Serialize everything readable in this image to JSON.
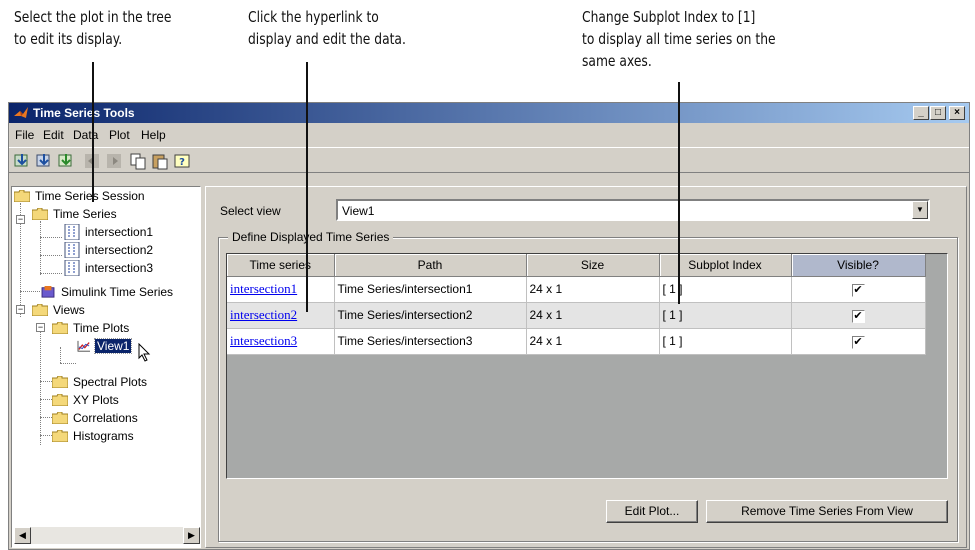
{
  "annotations": {
    "tree_note": [
      "Select the plot in the tree",
      "to edit its display."
    ],
    "link_note": [
      "Click the hyperlink to",
      "display and edit the data."
    ],
    "subplot_note": [
      "Change Subplot Index to [1]",
      "to display all time series on the",
      "same axes."
    ]
  },
  "window": {
    "title": "Time Series Tools",
    "controls": [
      "_",
      "□",
      "×"
    ]
  },
  "menu": [
    "File",
    "Edit",
    "Data",
    "Plot",
    "Help"
  ],
  "toolbar_icons": [
    "import-data-icon",
    "import-simulink-icon",
    "import-workspace-icon",
    "undo-icon",
    "redo-icon",
    "copy-icon",
    "paste-icon",
    "help-icon"
  ],
  "tree": {
    "nodes": [
      {
        "label": "Time Series Session"
      },
      {
        "label": "Time Series"
      },
      {
        "label": "intersection1"
      },
      {
        "label": "intersection2"
      },
      {
        "label": "intersection3"
      },
      {
        "label": "Simulink Time Series"
      },
      {
        "label": "Views"
      },
      {
        "label": "Time Plots"
      },
      {
        "label": "View1"
      },
      {
        "label": "Spectral Plots"
      },
      {
        "label": "XY Plots"
      },
      {
        "label": "Correlations"
      },
      {
        "label": "Histograms"
      }
    ]
  },
  "view": {
    "select_label": "Select view",
    "selected": "View1",
    "group_title": "Define Displayed Time Series"
  },
  "table": {
    "headers": [
      "Time series",
      "Path",
      "Size",
      "Subplot Index",
      "Visible?"
    ],
    "rows": [
      {
        "name": "intersection1",
        "path": "Time Series/intersection1",
        "size": "24 x 1",
        "subplot": "[ 1 ]",
        "visible": "✔"
      },
      {
        "name": "intersection2",
        "path": "Time Series/intersection2",
        "size": "24 x 1",
        "subplot": "[ 1 ]",
        "visible": "✔"
      },
      {
        "name": "intersection3",
        "path": "Time Series/intersection3",
        "size": "24 x 1",
        "subplot": "[ 1 ]",
        "visible": "✔"
      }
    ]
  },
  "buttons": {
    "edit_plot": "Edit Plot...",
    "remove": "Remove Time Series From View"
  },
  "scroll": {
    "left": "◀",
    "right": "▶"
  }
}
